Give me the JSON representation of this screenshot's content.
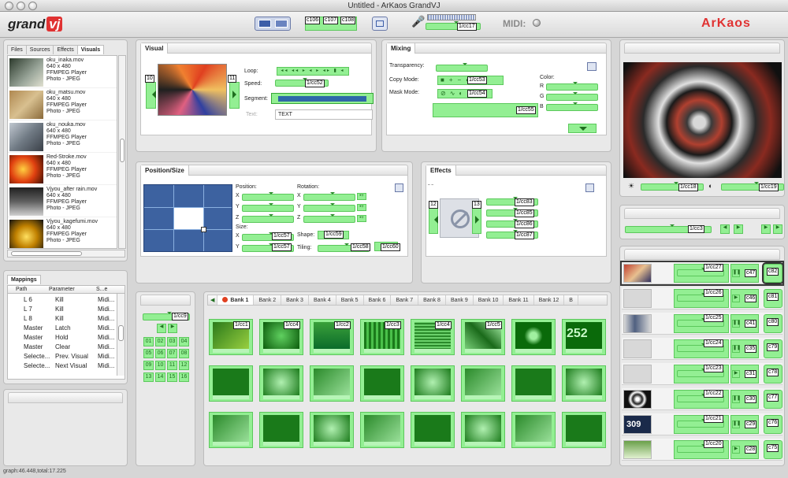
{
  "window": {
    "title": "Untitled - ArKaos GrandVJ"
  },
  "toolbar": {
    "logo_grand": "grand",
    "logo_vj": "vj",
    "midi_label": "MIDI:",
    "brand": "ArKaos",
    "mic_cc": "1/cc17",
    "cc_tags": [
      "c106",
      "c107",
      "c108"
    ]
  },
  "left": {
    "tabs": [
      "Files",
      "Sources",
      "Effects",
      "Visuals"
    ],
    "visuals": [
      {
        "name": "oku_inaka.mov",
        "size": "640 x 480",
        "player": "FFMPEG Player",
        "photo": "Photo - JPEG"
      },
      {
        "name": "oku_matsu.mov",
        "size": "640 x 480",
        "player": "FFMPEG Player",
        "photo": "Photo - JPEG"
      },
      {
        "name": "oku_nouka.mov",
        "size": "640 x 480",
        "player": "FFMPEG Player",
        "photo": "Photo - JPEG"
      },
      {
        "name": "Red-Stroke.mov",
        "size": "640 x 480",
        "player": "FFMPEG Player",
        "photo": "Photo - JPEG"
      },
      {
        "name": "Vjyou_after rain.mov",
        "size": "640 x 480",
        "player": "FFMPEG Player",
        "photo": "Photo - JPEG"
      },
      {
        "name": "Vjyou_kagefumi.mov",
        "size": "640 x 480",
        "player": "FFMPEG Player",
        "photo": "Photo - JPEG"
      }
    ]
  },
  "mappings": {
    "tab": "Mappings",
    "headers": [
      "Path",
      "Parameter",
      "S...e"
    ],
    "rows": [
      [
        "L 6",
        "Kill",
        "Midi..."
      ],
      [
        "L 7",
        "Kill",
        "Midi..."
      ],
      [
        "L 8",
        "Kill",
        "Midi..."
      ],
      [
        "Master",
        "Latch",
        "Midi..."
      ],
      [
        "Master",
        "Hold",
        "Midi..."
      ],
      [
        "Master",
        "Clear",
        "Midi..."
      ],
      [
        "Selecte...",
        "Prev. Visual",
        "Midi..."
      ],
      [
        "Selecte...",
        "Next Visual",
        "Midi..."
      ]
    ]
  },
  "status": {
    "text": "graph:46.448,total:17.225"
  },
  "visual_panel": {
    "title": "Visual",
    "loop": "Loop:",
    "speed": "Speed:",
    "segment": "Segment:",
    "text_label": "Text:",
    "text_value": "TEXT",
    "speed_cc": "1/cc52",
    "prev_num": "10",
    "next_num": "11"
  },
  "mixing": {
    "title": "Mixing",
    "transparency": "Transparency:",
    "copy_mode": "Copy Mode:",
    "mask_mode": "Mask Mode:",
    "color": "Color:",
    "r": "R",
    "g": "G",
    "b": "B",
    "copy_cc": "1/cc53",
    "mask_cc": "1/cc54",
    "bottom_cc": "1/cc55"
  },
  "position": {
    "title": "Position/Size",
    "position": "Position:",
    "rotation": "Rotation:",
    "size": "Size:",
    "shape": "Shape:",
    "tiling": "Tiling:",
    "x": "X",
    "y": "Y",
    "z": "Z",
    "size_x_cc": "1/cc57",
    "size_y_cc": "1/cc57",
    "shape_cc": "1/cc59",
    "tiling_cc": "1/cc58",
    "tiling2_cc": "1/cc60"
  },
  "effects": {
    "title": "Effects",
    "prev_num": "12",
    "next_num": "13",
    "ccs": [
      "1/cc83",
      "1/cc85",
      "1/cc86",
      "1/cc87"
    ]
  },
  "preview": {
    "bright_cc": "1/cc18",
    "contrast_cc": "1/cc19",
    "master_cc": "1/cc3"
  },
  "pad": {
    "cc": "1/cc9",
    "nums": [
      "01",
      "02",
      "03",
      "04",
      "05",
      "06",
      "07",
      "08",
      "09",
      "10",
      "11",
      "12",
      "13",
      "14",
      "15",
      "16"
    ]
  },
  "banks": {
    "tabs": [
      "Bank 1",
      "Bank 2",
      "Bank 3",
      "Bank 4",
      "Bank 5",
      "Bank 6",
      "Bank 7",
      "Bank 8",
      "Bank 9",
      "Bank 10",
      "Bank 11",
      "Bank 12",
      "B"
    ],
    "cells": [
      "1/cc1",
      "1/cc4",
      "1/cc2",
      "1/cc3",
      "1/cc4",
      "1/cc5",
      "",
      "252"
    ]
  },
  "layers": [
    {
      "cc": "1/cc27",
      "c": "c47",
      "k": "c82"
    },
    {
      "cc": "1/cc26",
      "c": "c46",
      "k": "c81"
    },
    {
      "cc": "1/cc25",
      "c": "c41",
      "k": "c80"
    },
    {
      "cc": "1/cc24",
      "c": "c35",
      "k": "c79"
    },
    {
      "cc": "1/cc23",
      "c": "c31",
      "k": "c78"
    },
    {
      "cc": "1/cc22",
      "c": "c30",
      "k": "c77"
    },
    {
      "cc": "1/cc21",
      "c": "c29",
      "k": "c76"
    },
    {
      "cc": "1/cc20",
      "c": "c28",
      "k": "c75"
    }
  ],
  "layer3_text": "309"
}
